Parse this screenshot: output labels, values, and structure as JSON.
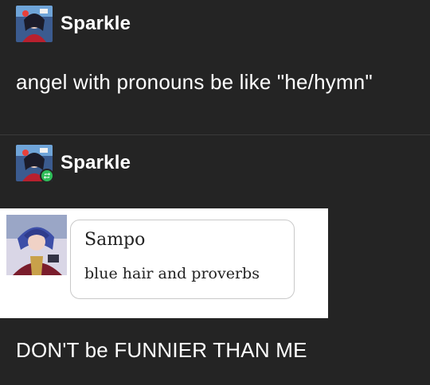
{
  "posts": [
    {
      "username": "Sparkle",
      "text": "angel with pronouns be like \"he/hymn\""
    },
    {
      "username": "Sparkle",
      "reblog_badge_icon": "reblog-icon",
      "embedded": {
        "name": "Sampo",
        "message": "blue hair and proverbs"
      },
      "text": "DON'T be FUNNIER THAN ME"
    }
  ],
  "colors": {
    "background": "#242424",
    "text": "#ffffff",
    "reblog_badge": "#2ebd59",
    "embed_background": "#ffffff",
    "embed_text": "#222222"
  }
}
